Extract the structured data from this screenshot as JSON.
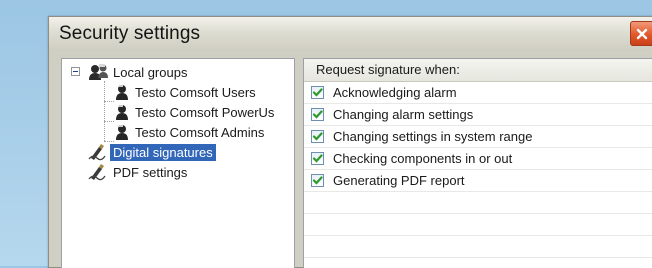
{
  "window": {
    "title": "Security settings",
    "close_icon": "close-icon"
  },
  "tree": {
    "groups_label": "Local groups",
    "groups": [
      {
        "label": "Testo Comsoft Users",
        "icon": "user-group-icon"
      },
      {
        "label": "Testo Comsoft PowerUs",
        "icon": "user-group-icon"
      },
      {
        "label": "Testo Comsoft Admins",
        "icon": "user-group-icon"
      }
    ],
    "digital_signatures_label": "Digital signatures",
    "pdf_settings_label": "PDF settings",
    "selected": "Digital signatures"
  },
  "signature_panel": {
    "header": "Request signature when:",
    "options": [
      {
        "label": "Acknowledging alarm",
        "checked": true
      },
      {
        "label": "Changing alarm settings",
        "checked": true
      },
      {
        "label": "Changing settings in system range",
        "checked": true
      },
      {
        "label": "Checking components in or out",
        "checked": true
      },
      {
        "label": "Generating PDF report",
        "checked": true
      }
    ]
  },
  "colors": {
    "selection": "#3166b8",
    "check": "#2e9a2e",
    "close_button": "#e2582a",
    "background": "#a9cfe9"
  }
}
